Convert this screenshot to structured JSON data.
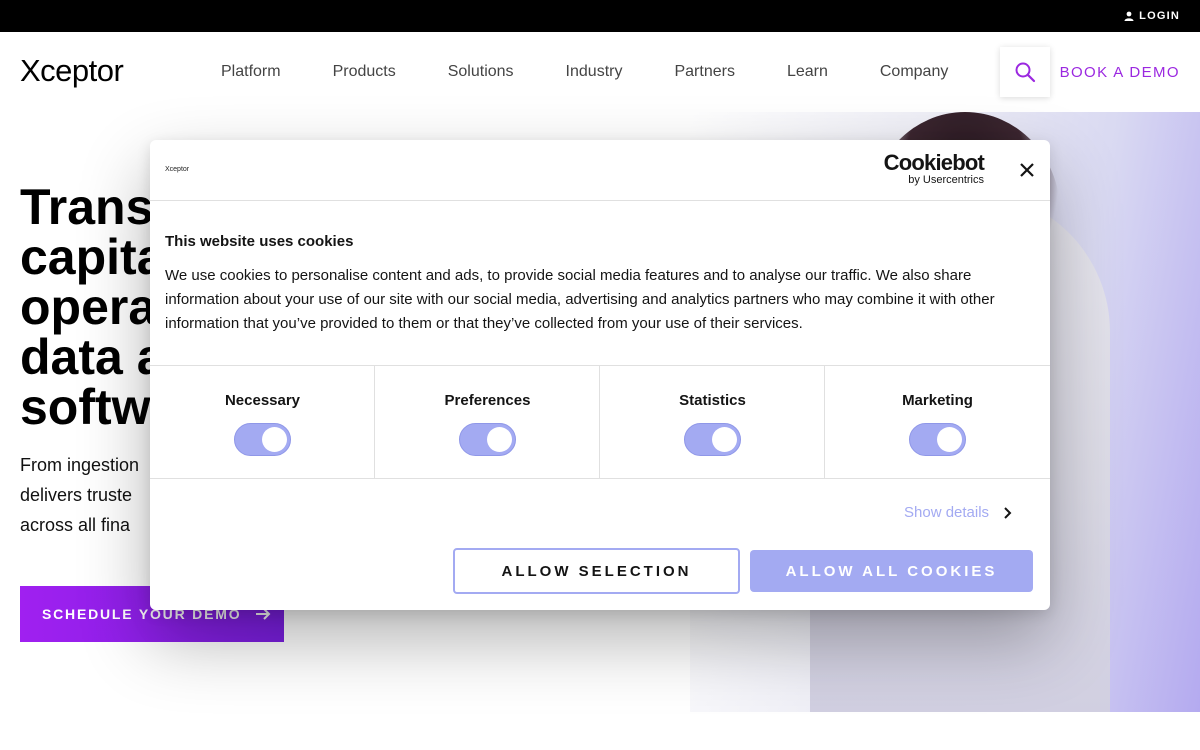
{
  "topbar": {
    "login_label": "LOGIN"
  },
  "header": {
    "logo": "Xceptor",
    "nav": [
      "Platform",
      "Products",
      "Solutions",
      "Industry",
      "Partners",
      "Learn",
      "Company"
    ],
    "book_demo": "BOOK A DEMO"
  },
  "hero": {
    "title_lines": [
      "Transf",
      "capita",
      "opera",
      "data a",
      "softw"
    ],
    "subtitle_lines": [
      "From ingestion",
      "delivers truste",
      "across all fina"
    ],
    "cta": "SCHEDULE YOUR DEMO"
  },
  "cookie_dialog": {
    "logo": "Xceptor",
    "brand_main": "Cookiebot",
    "brand_sub": "by Usercentrics",
    "title": "This website uses cookies",
    "text": "We use cookies to personalise content and ads, to provide social media features and to analyse our traffic. We also share information about your use of our site with our social media, advertising and analytics partners who may combine it with other information that you’ve provided to them or that they’ve collected from your use of their services.",
    "toggles": [
      {
        "label": "Necessary",
        "on": true
      },
      {
        "label": "Preferences",
        "on": true
      },
      {
        "label": "Statistics",
        "on": true
      },
      {
        "label": "Marketing",
        "on": true
      }
    ],
    "show_details": "Show details",
    "allow_selection": "ALLOW SELECTION",
    "allow_all": "ALLOW ALL COOKIES",
    "accent_color": "#a3aaf2"
  },
  "colors": {
    "brand_purple": "#9b28e0",
    "topbar": "#000000"
  },
  "icons": {
    "login": "user-icon",
    "search": "search-icon",
    "cta_arrow": "arrow-right-icon",
    "close": "close-icon",
    "details": "chevron-right-icon"
  }
}
